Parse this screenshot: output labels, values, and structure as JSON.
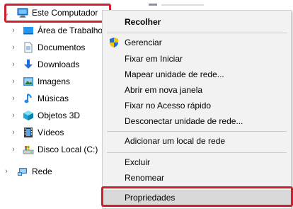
{
  "tree": {
    "root": {
      "label": "Este Computador",
      "icon": "computer-icon"
    },
    "items": [
      {
        "label": "Área de Trabalho",
        "icon": "desktop-icon"
      },
      {
        "label": "Documentos",
        "icon": "documents-icon"
      },
      {
        "label": "Downloads",
        "icon": "downloads-icon"
      },
      {
        "label": "Imagens",
        "icon": "pictures-icon"
      },
      {
        "label": "Músicas",
        "icon": "music-icon"
      },
      {
        "label": "Objetos 3D",
        "icon": "objects-3d-icon"
      },
      {
        "label": "Vídeos",
        "icon": "videos-icon"
      },
      {
        "label": "Disco Local (C:)",
        "icon": "drive-icon"
      }
    ],
    "network": {
      "label": "Rede",
      "icon": "network-icon"
    }
  },
  "context_menu": {
    "items": [
      {
        "label": "Recolher",
        "bold": true
      },
      {
        "label": "Gerenciar",
        "icon": "shield-icon"
      },
      {
        "label": "Fixar em Iniciar"
      },
      {
        "label": "Mapear unidade de rede..."
      },
      {
        "label": "Abrir em nova janela"
      },
      {
        "label": "Fixar no Acesso rápido"
      },
      {
        "label": "Desconectar unidade de rede..."
      },
      {
        "label": "Adicionar um local de rede"
      },
      {
        "label": "Excluir"
      },
      {
        "label": "Renomear"
      },
      {
        "label": "Propriedades",
        "highlighted": true
      }
    ]
  },
  "colors": {
    "highlight_border": "#d0202d",
    "menu_bg": "#f2f2f2",
    "hover_bg": "#d9d9d9"
  }
}
